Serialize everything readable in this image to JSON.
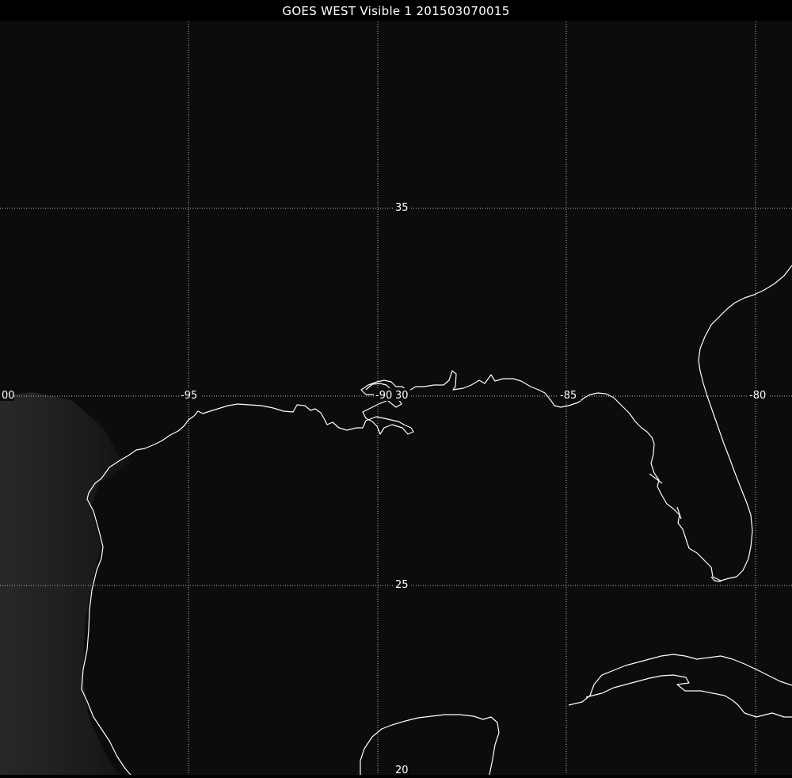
{
  "title": "GOES WEST Visible 1 201503070015",
  "grid_labels": {
    "lon_left_edge": "00",
    "lon_95": "-95",
    "lon_90": "-90",
    "lon_85": "-85",
    "lon_80": "-80",
    "lat_35": "35",
    "lat_30": "30",
    "lat_25": "25",
    "lat_20": "20"
  },
  "colors": {
    "background": "#0b0b0b",
    "land_haze": "#2a2a2a",
    "coastline": "#ffffff",
    "graticule": "#bbbbbb"
  }
}
